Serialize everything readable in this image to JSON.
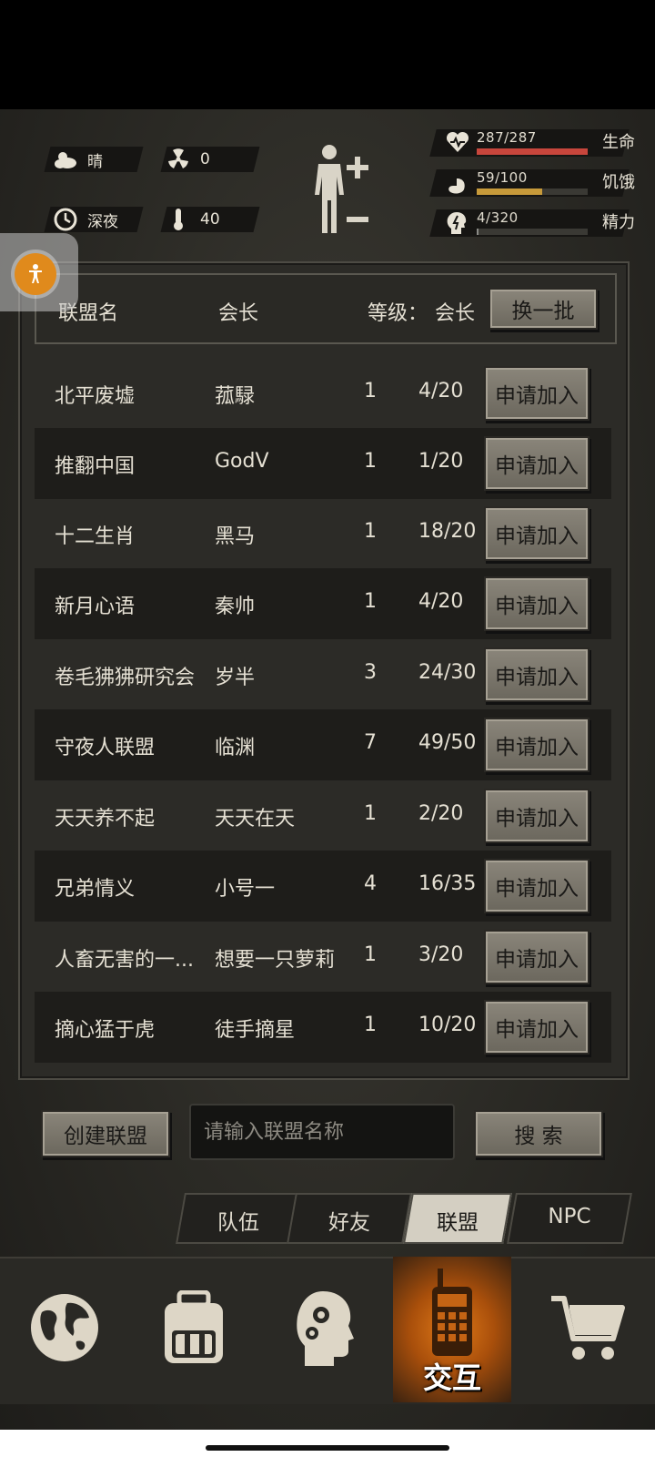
{
  "status": {
    "weather": "晴",
    "radiation": "0",
    "time_of_day": "深夜",
    "temperature": "40"
  },
  "vitals": [
    {
      "value": "287/287",
      "label": "生命",
      "fraction": 1.0,
      "color": "#c8463c"
    },
    {
      "value": "59/100",
      "label": "饥饿",
      "fraction": 0.59,
      "color": "#c79a3a"
    },
    {
      "value": "4/320",
      "label": "精力",
      "fraction": 0.0125,
      "color": "#8a8a86"
    }
  ],
  "header": {
    "name": "联盟名",
    "leader": "会长",
    "level": "等级：",
    "members": "会长",
    "refresh": "换一批"
  },
  "join_label": "申请加入",
  "alliances": [
    {
      "name": "北平废墟",
      "leader": "菰騄",
      "level": "1",
      "members": "4/20"
    },
    {
      "name": "推翻中国",
      "leader": "GodV",
      "level": "1",
      "members": "1/20"
    },
    {
      "name": "十二生肖",
      "leader": "黑马",
      "level": "1",
      "members": "18/20"
    },
    {
      "name": "新月心语",
      "leader": "秦帅",
      "level": "1",
      "members": "4/20"
    },
    {
      "name": "卷毛狒狒研究会",
      "leader": "岁半",
      "level": "3",
      "members": "24/30"
    },
    {
      "name": "守夜人联盟",
      "leader": "临渊",
      "level": "7",
      "members": "49/50"
    },
    {
      "name": "天天养不起",
      "leader": "天天在天",
      "level": "1",
      "members": "2/20"
    },
    {
      "name": "兄弟情义",
      "leader": "小号一",
      "level": "4",
      "members": "16/35"
    },
    {
      "name": "人畜无害的一...",
      "leader": "想要一只萝莉",
      "level": "1",
      "members": "3/20"
    },
    {
      "name": "摘心猛于虎",
      "leader": "徒手摘星",
      "level": "1",
      "members": "10/20"
    }
  ],
  "actions": {
    "create": "创建联盟",
    "search_placeholder": "请输入联盟名称",
    "search": "搜 索"
  },
  "tabs": [
    "队伍",
    "好友",
    "联盟",
    "NPC"
  ],
  "nav": {
    "active_label": "交互"
  }
}
